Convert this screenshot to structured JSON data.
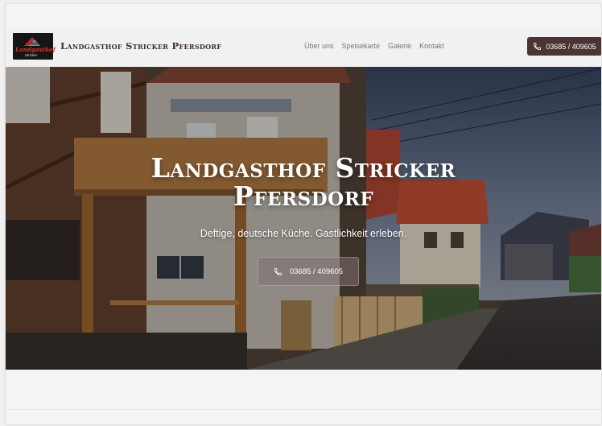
{
  "site": {
    "logo_text": "Landgasthof",
    "logo_sub": "Stricker",
    "brand": "Landgasthof Stricker Pfersdorf"
  },
  "nav": {
    "items": [
      {
        "label": "Über uns"
      },
      {
        "label": "Speisekarte"
      },
      {
        "label": "Galerie"
      },
      {
        "label": "Kontakt"
      }
    ],
    "phone_label": "03685 / 409605"
  },
  "hero": {
    "title_line1": "Landgasthof Stricker",
    "title_line2": "Pfersdorf",
    "subtitle": "Deftige, deutsche Küche. Gastlichkeit erleben.",
    "button_label": "03685 / 409605"
  },
  "colors": {
    "brand_dark": "#4a3434",
    "logo_red": "#e4332b",
    "nav_text": "#7d7373"
  },
  "icons": {
    "logo": "roof-logo-icon",
    "phone": "phone-icon"
  }
}
